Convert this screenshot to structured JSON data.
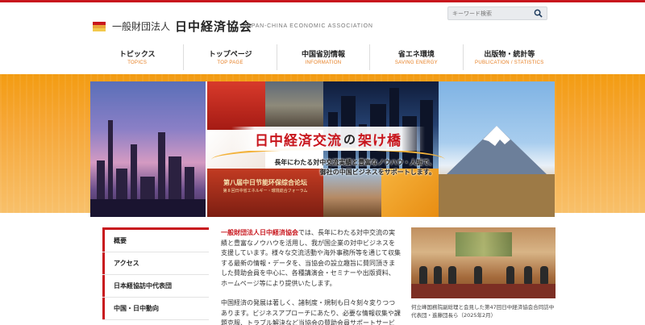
{
  "header": {
    "org_type": "一般財団法人",
    "org_name": "日中経済協会",
    "org_name_en": "JAPAN-CHINA ECONOMIC ASSOCIATION",
    "search_placeholder": "キーワード検索"
  },
  "nav": [
    {
      "jp": "トピックス",
      "en": "TOPICS"
    },
    {
      "jp": "トップページ",
      "en": "TOP PAGE"
    },
    {
      "jp": "中国省別情報",
      "en": "INFORMATION"
    },
    {
      "jp": "省エネ環境",
      "en": "SAVING ENERGY"
    },
    {
      "jp": "出版物・統計等",
      "en": "PUBLICATION / STATISTICS"
    }
  ],
  "hero": {
    "title_a": "日中経済交流",
    "title_no": "の",
    "title_b": "架け橋",
    "subtitle_1": "長年にわたる対中交流実績と豊富なノウハウ・人脈で、",
    "subtitle_2": "御社の中国ビジネスをサポートします。",
    "conference_line1": "第八届中日节能环保综合论坛",
    "conference_line2": "第８回日中省エネルギー・環境総合フォーラム"
  },
  "sidebar": [
    {
      "label": "概要"
    },
    {
      "label": "アクセス"
    },
    {
      "label": "日本経協訪中代表団"
    },
    {
      "label": "中国・日中動向"
    }
  ],
  "intro": {
    "highlight": "一般財団法人日中経済協会",
    "para1_rest": "では、長年にわたる対中交流の実績と豊富なノウハウを活用し、我が国企業の対中ビジネスを支援しています。様々な交流活動や海外事務所等を通じて収集する最新の情報・データを、当協会の設立趣旨に賛同頂きました賛助会員を中心に、各種講演会・セミナーや出版資料、ホームページ等により提供いたします。",
    "para2": "中国経済の発展は著しく、諸制度・規制も日々刻々変りつつあります。ビジネスアプローチにあたり、必要な情報収集や課題克服、トラブル解決など当協会の賛助会員サポートサービスを"
  },
  "photo": {
    "caption": "何立峰国務院副総理と会見した第47回日中経済協会合同訪中代表団・進藤団長ら（2025年2月）"
  },
  "colors": {
    "accent": "#c8161d",
    "orange": "#f39c12",
    "nav_en": "#e67e22"
  }
}
